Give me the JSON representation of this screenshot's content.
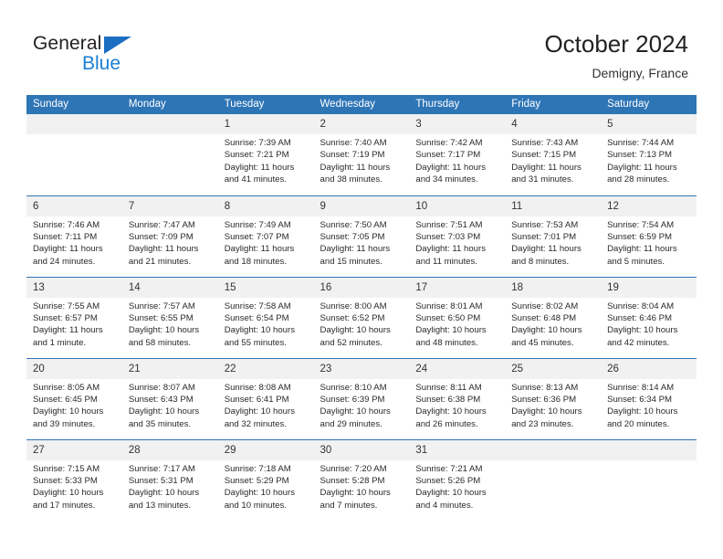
{
  "brand": {
    "name_part1": "General",
    "name_part2": "Blue",
    "triangle_color": "#1b6ec2",
    "text_color": "#231f20",
    "accent_color": "#1b7fd4"
  },
  "header": {
    "title": "October 2024",
    "location": "Demigny, France"
  },
  "theme": {
    "header_blue": "#2e75b6",
    "daynum_band": "#f1f1f1",
    "text": "#2a2a2a"
  },
  "weekday_headers": [
    "Sunday",
    "Monday",
    "Tuesday",
    "Wednesday",
    "Thursday",
    "Friday",
    "Saturday"
  ],
  "weeks": [
    [
      {
        "day": "",
        "sunrise": "",
        "sunset": "",
        "daylight": "",
        "blank": true
      },
      {
        "day": "",
        "sunrise": "",
        "sunset": "",
        "daylight": "",
        "blank": true
      },
      {
        "day": "1",
        "sunrise": "Sunrise: 7:39 AM",
        "sunset": "Sunset: 7:21 PM",
        "daylight": "Daylight: 11 hours and 41 minutes."
      },
      {
        "day": "2",
        "sunrise": "Sunrise: 7:40 AM",
        "sunset": "Sunset: 7:19 PM",
        "daylight": "Daylight: 11 hours and 38 minutes."
      },
      {
        "day": "3",
        "sunrise": "Sunrise: 7:42 AM",
        "sunset": "Sunset: 7:17 PM",
        "daylight": "Daylight: 11 hours and 34 minutes."
      },
      {
        "day": "4",
        "sunrise": "Sunrise: 7:43 AM",
        "sunset": "Sunset: 7:15 PM",
        "daylight": "Daylight: 11 hours and 31 minutes."
      },
      {
        "day": "5",
        "sunrise": "Sunrise: 7:44 AM",
        "sunset": "Sunset: 7:13 PM",
        "daylight": "Daylight: 11 hours and 28 minutes."
      }
    ],
    [
      {
        "day": "6",
        "sunrise": "Sunrise: 7:46 AM",
        "sunset": "Sunset: 7:11 PM",
        "daylight": "Daylight: 11 hours and 24 minutes."
      },
      {
        "day": "7",
        "sunrise": "Sunrise: 7:47 AM",
        "sunset": "Sunset: 7:09 PM",
        "daylight": "Daylight: 11 hours and 21 minutes."
      },
      {
        "day": "8",
        "sunrise": "Sunrise: 7:49 AM",
        "sunset": "Sunset: 7:07 PM",
        "daylight": "Daylight: 11 hours and 18 minutes."
      },
      {
        "day": "9",
        "sunrise": "Sunrise: 7:50 AM",
        "sunset": "Sunset: 7:05 PM",
        "daylight": "Daylight: 11 hours and 15 minutes."
      },
      {
        "day": "10",
        "sunrise": "Sunrise: 7:51 AM",
        "sunset": "Sunset: 7:03 PM",
        "daylight": "Daylight: 11 hours and 11 minutes."
      },
      {
        "day": "11",
        "sunrise": "Sunrise: 7:53 AM",
        "sunset": "Sunset: 7:01 PM",
        "daylight": "Daylight: 11 hours and 8 minutes."
      },
      {
        "day": "12",
        "sunrise": "Sunrise: 7:54 AM",
        "sunset": "Sunset: 6:59 PM",
        "daylight": "Daylight: 11 hours and 5 minutes."
      }
    ],
    [
      {
        "day": "13",
        "sunrise": "Sunrise: 7:55 AM",
        "sunset": "Sunset: 6:57 PM",
        "daylight": "Daylight: 11 hours and 1 minute."
      },
      {
        "day": "14",
        "sunrise": "Sunrise: 7:57 AM",
        "sunset": "Sunset: 6:55 PM",
        "daylight": "Daylight: 10 hours and 58 minutes."
      },
      {
        "day": "15",
        "sunrise": "Sunrise: 7:58 AM",
        "sunset": "Sunset: 6:54 PM",
        "daylight": "Daylight: 10 hours and 55 minutes."
      },
      {
        "day": "16",
        "sunrise": "Sunrise: 8:00 AM",
        "sunset": "Sunset: 6:52 PM",
        "daylight": "Daylight: 10 hours and 52 minutes."
      },
      {
        "day": "17",
        "sunrise": "Sunrise: 8:01 AM",
        "sunset": "Sunset: 6:50 PM",
        "daylight": "Daylight: 10 hours and 48 minutes."
      },
      {
        "day": "18",
        "sunrise": "Sunrise: 8:02 AM",
        "sunset": "Sunset: 6:48 PM",
        "daylight": "Daylight: 10 hours and 45 minutes."
      },
      {
        "day": "19",
        "sunrise": "Sunrise: 8:04 AM",
        "sunset": "Sunset: 6:46 PM",
        "daylight": "Daylight: 10 hours and 42 minutes."
      }
    ],
    [
      {
        "day": "20",
        "sunrise": "Sunrise: 8:05 AM",
        "sunset": "Sunset: 6:45 PM",
        "daylight": "Daylight: 10 hours and 39 minutes."
      },
      {
        "day": "21",
        "sunrise": "Sunrise: 8:07 AM",
        "sunset": "Sunset: 6:43 PM",
        "daylight": "Daylight: 10 hours and 35 minutes."
      },
      {
        "day": "22",
        "sunrise": "Sunrise: 8:08 AM",
        "sunset": "Sunset: 6:41 PM",
        "daylight": "Daylight: 10 hours and 32 minutes."
      },
      {
        "day": "23",
        "sunrise": "Sunrise: 8:10 AM",
        "sunset": "Sunset: 6:39 PM",
        "daylight": "Daylight: 10 hours and 29 minutes."
      },
      {
        "day": "24",
        "sunrise": "Sunrise: 8:11 AM",
        "sunset": "Sunset: 6:38 PM",
        "daylight": "Daylight: 10 hours and 26 minutes."
      },
      {
        "day": "25",
        "sunrise": "Sunrise: 8:13 AM",
        "sunset": "Sunset: 6:36 PM",
        "daylight": "Daylight: 10 hours and 23 minutes."
      },
      {
        "day": "26",
        "sunrise": "Sunrise: 8:14 AM",
        "sunset": "Sunset: 6:34 PM",
        "daylight": "Daylight: 10 hours and 20 minutes."
      }
    ],
    [
      {
        "day": "27",
        "sunrise": "Sunrise: 7:15 AM",
        "sunset": "Sunset: 5:33 PM",
        "daylight": "Daylight: 10 hours and 17 minutes."
      },
      {
        "day": "28",
        "sunrise": "Sunrise: 7:17 AM",
        "sunset": "Sunset: 5:31 PM",
        "daylight": "Daylight: 10 hours and 13 minutes."
      },
      {
        "day": "29",
        "sunrise": "Sunrise: 7:18 AM",
        "sunset": "Sunset: 5:29 PM",
        "daylight": "Daylight: 10 hours and 10 minutes."
      },
      {
        "day": "30",
        "sunrise": "Sunrise: 7:20 AM",
        "sunset": "Sunset: 5:28 PM",
        "daylight": "Daylight: 10 hours and 7 minutes."
      },
      {
        "day": "31",
        "sunrise": "Sunrise: 7:21 AM",
        "sunset": "Sunset: 5:26 PM",
        "daylight": "Daylight: 10 hours and 4 minutes."
      },
      {
        "day": "",
        "sunrise": "",
        "sunset": "",
        "daylight": "",
        "blank": true
      },
      {
        "day": "",
        "sunrise": "",
        "sunset": "",
        "daylight": "",
        "blank": true
      }
    ]
  ]
}
